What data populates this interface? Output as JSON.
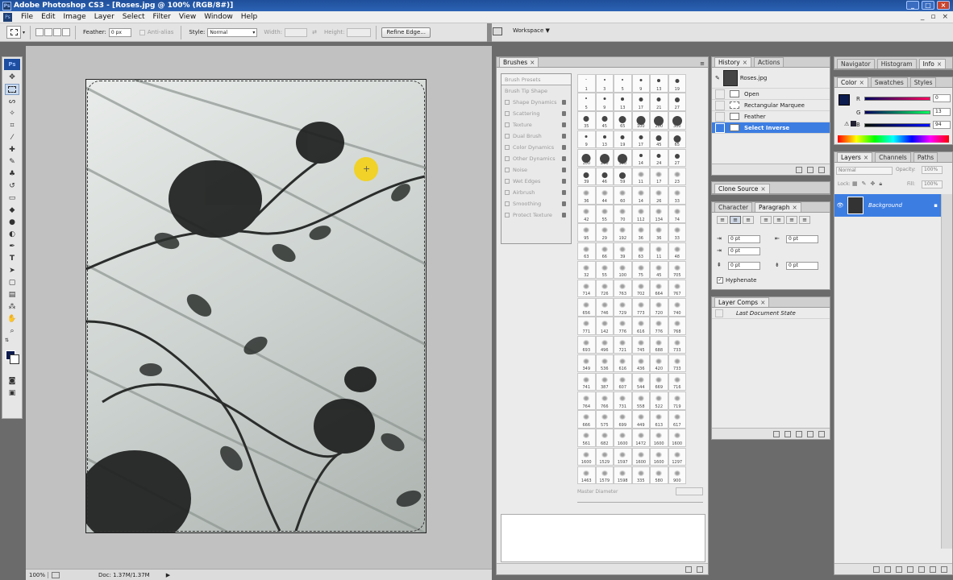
{
  "window": {
    "title": "Adobe Photoshop CS3 - [Roses.jpg @ 100% (RGB/8#)]",
    "ps_logo": "Ps"
  },
  "menu": [
    "File",
    "Edit",
    "Image",
    "Layer",
    "Select",
    "Filter",
    "View",
    "Window",
    "Help"
  ],
  "options": {
    "feather_label": "Feather:",
    "feather_value": "0 px",
    "antialias_label": "Anti-alias",
    "style_label": "Style:",
    "style_value": "Normal",
    "width_label": "Width:",
    "height_label": "Height:",
    "refine_edge": "Refine Edge...",
    "workspace": "Workspace ▼"
  },
  "tools": [
    "selection-marquee",
    "move",
    "lasso",
    "magic-wand",
    "crop",
    "slice",
    "healing",
    "brush",
    "clone-stamp",
    "history-brush",
    "eraser",
    "paint-bucket",
    "blur",
    "dodge",
    "pen",
    "type",
    "path-select",
    "shape",
    "notes",
    "eyedropper",
    "hand",
    "zoom"
  ],
  "foreground_color": "#0d1c4f",
  "status": {
    "zoom": "100%",
    "doc": "Doc: 1.37M/1.37M"
  },
  "brushes": {
    "tab": "Brushes",
    "presets_label": "Brush Presets",
    "tip_shape_label": "Brush Tip Shape",
    "options": [
      "Shape Dynamics",
      "Scattering",
      "Texture",
      "Dual Brush",
      "Color Dynamics",
      "Other Dynamics",
      "Noise",
      "Wet Edges",
      "Airbrush",
      "Smoothing",
      "Protect Texture"
    ],
    "master_diameter": "Master Diameter",
    "sizes": [
      "1",
      "3",
      "5",
      "9",
      "13",
      "19",
      "5",
      "9",
      "13",
      "17",
      "21",
      "27",
      "35",
      "45",
      "65",
      "100",
      "200",
      "300",
      "9",
      "13",
      "19",
      "17",
      "45",
      "65",
      "100",
      "200",
      "300",
      "14",
      "24",
      "27",
      "39",
      "46",
      "59",
      "11",
      "17",
      "23",
      "36",
      "44",
      "60",
      "14",
      "26",
      "33",
      "42",
      "55",
      "70",
      "112",
      "134",
      "74",
      "95",
      "29",
      "192",
      "36",
      "36",
      "33",
      "63",
      "66",
      "39",
      "63",
      "11",
      "48",
      "32",
      "55",
      "100",
      "75",
      "45",
      "705",
      "714",
      "726",
      "763",
      "702",
      "664",
      "767",
      "656",
      "746",
      "729",
      "773",
      "720",
      "740",
      "771",
      "142",
      "776",
      "616",
      "776",
      "768",
      "693",
      "496",
      "721",
      "745",
      "688",
      "733",
      "349",
      "536",
      "616",
      "436",
      "420",
      "733",
      "741",
      "387",
      "607",
      "544",
      "669",
      "716",
      "764",
      "766",
      "731",
      "558",
      "522",
      "719",
      "666",
      "575",
      "699",
      "449",
      "613",
      "617",
      "561",
      "682",
      "1600",
      "1472",
      "1600",
      "1600",
      "1600",
      "1529",
      "1597",
      "1600",
      "1600",
      "1297",
      "1463",
      "1579",
      "1598",
      "335",
      "580",
      "900"
    ]
  },
  "history": {
    "tabs": [
      "History",
      "Actions"
    ],
    "snapshot": "Roses.jpg",
    "steps": [
      "Open",
      "Rectangular Marquee",
      "Feather",
      "Select Inverse"
    ],
    "selected_step": "Select Inverse"
  },
  "clone_source": {
    "tab": "Clone Source"
  },
  "paragraph": {
    "tabs": [
      "Character",
      "Paragraph"
    ],
    "indent_left": "0 pt",
    "indent_right": "0 pt",
    "indent_first": "0 pt",
    "space_before": "0 pt",
    "space_after": "0 pt",
    "hyphenate": "Hyphenate"
  },
  "layer_comps": {
    "tab": "Layer Comps",
    "item": "Last Document State"
  },
  "navigator": {
    "tabs": [
      "Navigator",
      "Histogram",
      "Info"
    ]
  },
  "color": {
    "tabs": [
      "Color",
      "Swatches",
      "Styles"
    ],
    "r_label": "R",
    "r": "0",
    "g_label": "G",
    "g": "13",
    "b_label": "B",
    "b": "94"
  },
  "layers": {
    "tabs": [
      "Layers",
      "Channels",
      "Paths"
    ],
    "blend": "Normal",
    "opacity_label": "Opacity:",
    "opacity": "100%",
    "lock_label": "Lock:",
    "fill_label": "Fill:",
    "fill": "100%",
    "layer_name": "Background"
  }
}
